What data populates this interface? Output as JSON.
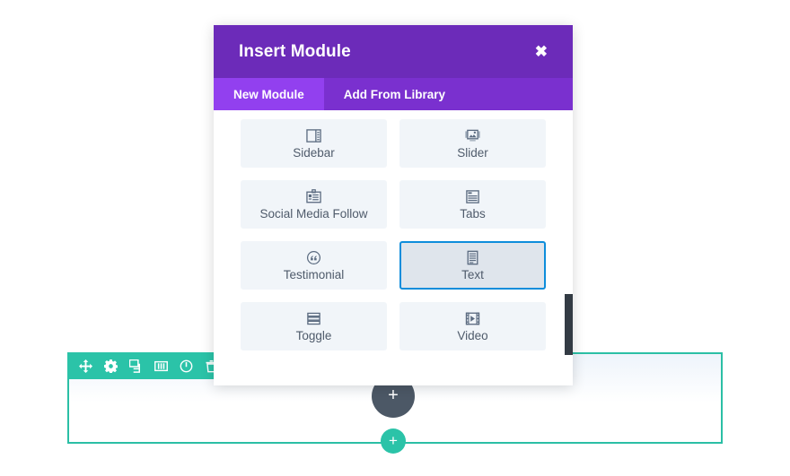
{
  "modal": {
    "title": "Insert Module",
    "close_label": "✖",
    "close_icon": "close-icon",
    "tabs": [
      {
        "label": "New Module",
        "active": true
      },
      {
        "label": "Add From Library",
        "active": false
      }
    ],
    "modules": [
      {
        "label": "Sidebar",
        "icon": "sidebar-icon",
        "selected": false
      },
      {
        "label": "Slider",
        "icon": "slider-icon",
        "selected": false
      },
      {
        "label": "Social Media Follow",
        "icon": "contact-card-icon",
        "selected": false
      },
      {
        "label": "Tabs",
        "icon": "tabs-icon",
        "selected": false
      },
      {
        "label": "Testimonial",
        "icon": "quote-circle-icon",
        "selected": false
      },
      {
        "label": "Text",
        "icon": "text-document-icon",
        "selected": true
      },
      {
        "label": "Toggle",
        "icon": "toggle-rows-icon",
        "selected": false
      },
      {
        "label": "Video",
        "icon": "film-play-icon",
        "selected": false
      }
    ],
    "colors": {
      "header": "#6c2bb9",
      "tab_bar": "#7a30cf",
      "tab_active": "#9240ef",
      "selection_border": "#0d8ddb",
      "tile_background": "#f1f5f9"
    }
  },
  "builder": {
    "row_toolbar": [
      {
        "icon": "move-icon",
        "name": "move-row-button"
      },
      {
        "icon": "gear-icon",
        "name": "row-settings-button"
      },
      {
        "icon": "duplicate-icon",
        "name": "duplicate-row-button"
      },
      {
        "icon": "columns-icon",
        "name": "change-columns-button"
      },
      {
        "icon": "power-icon",
        "name": "disable-row-button"
      },
      {
        "icon": "trash-icon",
        "name": "delete-row-button"
      }
    ],
    "add_row_label": "+",
    "add_section_label": "+",
    "colors": {
      "row_accent": "#2bbfa5",
      "toolbar": "#2bc3a8",
      "section_blob": "#4c5866"
    }
  }
}
